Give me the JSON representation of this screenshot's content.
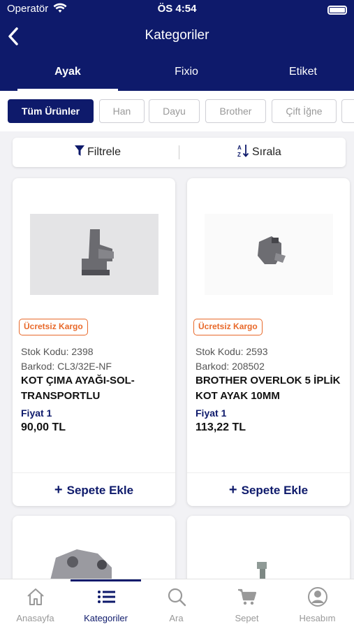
{
  "status": {
    "carrier": "Operatör",
    "time": "ÖS 4:54"
  },
  "header": {
    "title": "Kategoriler"
  },
  "tabs": [
    {
      "label": "Ayak",
      "active": true
    },
    {
      "label": "Fixio",
      "active": false
    },
    {
      "label": "Etiket",
      "active": false
    }
  ],
  "chips": [
    {
      "label": "Tüm Ürünler",
      "active": true
    },
    {
      "label": "Han",
      "active": false
    },
    {
      "label": "Dayu",
      "active": false
    },
    {
      "label": "Brother",
      "active": false
    },
    {
      "label": "Çift İğne",
      "active": false
    }
  ],
  "toolbar": {
    "filter_label": "Filtrele",
    "sort_label": "Sırala"
  },
  "products": [
    {
      "badge": "Ücretsiz Kargo",
      "stock": "Stok Kodu: 2398",
      "barcode": "Barkod: CL3/32E-NF",
      "name": "KOT ÇIMA AYAĞI-SOL-TRANSPORTLU",
      "price_label": "Fiyat 1",
      "price": "90,00 TL",
      "cart_label": "Sepete Ekle"
    },
    {
      "badge": "Ücretsiz Kargo",
      "stock": "Stok Kodu: 2593",
      "barcode": "Barkod: 208502",
      "name": "BROTHER OVERLOK 5 İPLİK KOT AYAK 10MM",
      "price_label": "Fiyat 1",
      "price": "113,22 TL",
      "cart_label": "Sepete Ekle"
    }
  ],
  "bottom_nav": [
    {
      "label": "Anasayfa",
      "icon": "home-icon",
      "active": false
    },
    {
      "label": "Kategoriler",
      "icon": "list-icon",
      "active": true
    },
    {
      "label": "Ara",
      "icon": "search-icon",
      "active": false
    },
    {
      "label": "Sepet",
      "icon": "cart-icon",
      "active": false
    },
    {
      "label": "Hesabım",
      "icon": "account-icon",
      "active": false
    }
  ],
  "colors": {
    "primary": "#0e1a6b",
    "badge": "#e8692a",
    "background": "#f2f2f5"
  }
}
